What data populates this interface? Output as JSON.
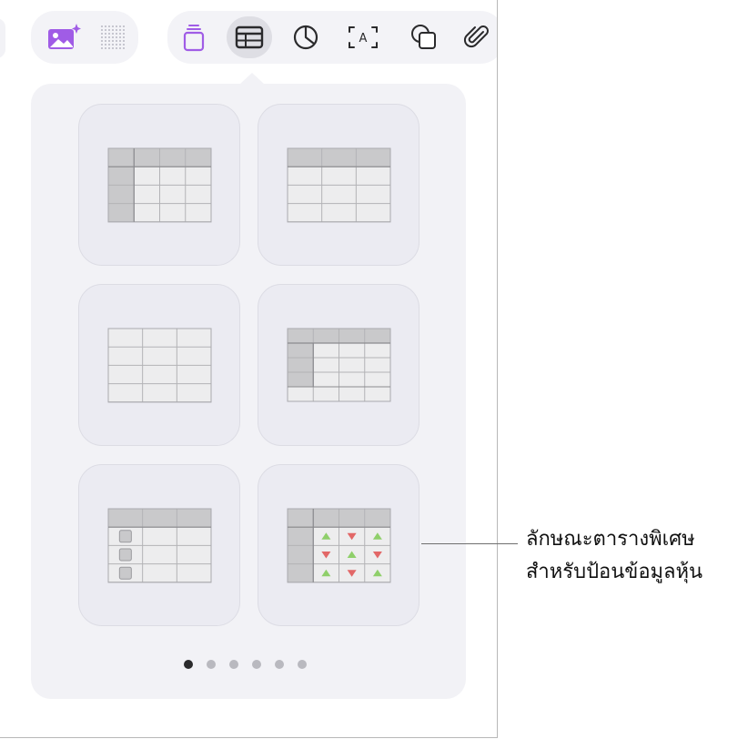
{
  "toolbar": {
    "left_group": [
      {
        "icon": "image-sparkle-icon",
        "color": "#a05ce6"
      },
      {
        "icon": "dot-grid-icon",
        "color": "#b9b9c2"
      }
    ],
    "right_group": [
      {
        "icon": "stack-icon",
        "color": "#a05ce6"
      },
      {
        "icon": "table-icon",
        "color": "#2a2a2c",
        "selected": true
      },
      {
        "icon": "chart-icon",
        "color": "#2a2a2c"
      },
      {
        "icon": "text-box-icon",
        "color": "#2a2a2c",
        "glyph": "A"
      },
      {
        "icon": "shapes-icon",
        "color": "#2a2a2c"
      },
      {
        "icon": "paperclip-icon",
        "color": "#2a2a2c"
      }
    ]
  },
  "table_styles": [
    {
      "name": "header-row-and-column-table",
      "header_color": "#c9c9cb",
      "body_color": "#ededee"
    },
    {
      "name": "header-row-table",
      "header_color": "#c9c9cb",
      "body_color": "#ededee"
    },
    {
      "name": "plain-table",
      "header_color": "#ededee",
      "body_color": "#ededee"
    },
    {
      "name": "header-row-column-footer-table",
      "header_color": "#c9c9cb",
      "body_color": "#ededee"
    },
    {
      "name": "checklist-table",
      "header_color": "#c9c9cb",
      "body_color": "#ededee"
    },
    {
      "name": "stock-table",
      "header_color": "#c9c9cb",
      "body_color": "#ededee",
      "up_color": "#8fcf6a",
      "down_color": "#e26767"
    }
  ],
  "pagination": {
    "total": 6,
    "current": 1
  },
  "callout": {
    "line1": "ลักษณะตารางพิเศษ",
    "line2": "สำหรับป้อนข้อมูลหุ้น"
  }
}
